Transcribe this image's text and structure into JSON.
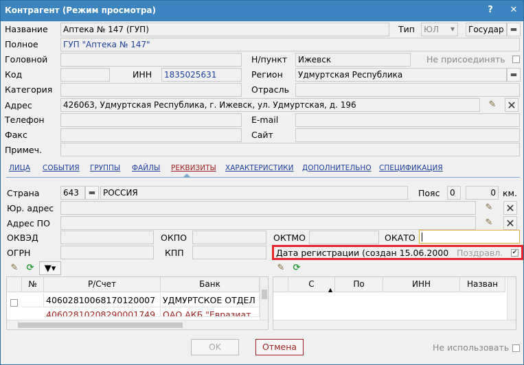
{
  "window": {
    "title": "Контрагент (Режим просмотра)",
    "help": "?",
    "close": "✕"
  },
  "labels": {
    "name": "Название",
    "full": "Полное",
    "head": "Головной",
    "code": "Код",
    "inn": "ИНН",
    "category": "Категория",
    "address": "Адрес",
    "phone": "Телефон",
    "fax": "Факс",
    "note": "Примеч.",
    "type": "Тип",
    "city": "Н/пункт",
    "region": "Регион",
    "branch": "Отрасль",
    "email": "E-mail",
    "site": "Сайт",
    "not_join": "Не присоединять"
  },
  "values": {
    "name": "Аптека № 147 (ГУП)",
    "full": "ГУП \"Аптека № 147\"",
    "head": "",
    "code": "",
    "inn": "1835025631",
    "category": "",
    "address": "426063, Удмуртская Республика, г. Ижевск, ул. Удмуртская, д. 196",
    "phone": "",
    "fax": "",
    "note": "",
    "type": "ЮЛ",
    "type2": "Государ",
    "city": "Ижевск",
    "region": "Удмуртская Республика",
    "branch": "",
    "email": "",
    "site": ""
  },
  "tabs": [
    "ЛИЦА",
    "СОБЫТИЯ",
    "ГРУППЫ",
    "ФАЙЛЫ",
    "РЕКВИЗИТЫ",
    "ХАРАКТЕРИСТИКИ",
    "ДОПОЛНИТЕЛЬНО",
    "СПЕЦИФИКАЦИЯ"
  ],
  "active_tab": "РЕКВИЗИТЫ",
  "req": {
    "country_label": "Страна",
    "country_code": "643",
    "country": "РОССИЯ",
    "belt_label": "Пояс",
    "belt": "0",
    "km_value": "0",
    "km": "км.",
    "legal_addr_label": "Юр. адрес",
    "postal_addr_label": "Адрес ПО",
    "okved": "ОКВЭД",
    "okpo": "ОКПО",
    "oktmo": "ОКТМО",
    "okato": "ОКАТО",
    "ogrn": "ОГРН",
    "kpp": "КПП",
    "reg_date": "Дата регистрации (создан 15.06.2000",
    "congrats": "Поздравл.",
    "congrats_checked": "✔"
  },
  "left_grid": {
    "headers": [
      "№",
      "Р/Счет",
      "Банк"
    ],
    "rows": [
      {
        "account": "40602810068170120007",
        "bank": "УДМУРТСКОЕ ОТДЕЛ"
      },
      {
        "account": "40602810208290001749",
        "bank": "ОАО АКБ \"Евразиат"
      }
    ]
  },
  "right_grid": {
    "headers": [
      "С",
      "По",
      "ИНН",
      "Назван"
    ]
  },
  "footer": {
    "ok": "OK",
    "cancel": "Отмена",
    "not_use": "Не использовать"
  },
  "colors": {
    "titlebar": "#3b84bf",
    "highlight": "#e8222a",
    "link": "#1f3f9c",
    "active_tab": "#9c1f1f"
  }
}
